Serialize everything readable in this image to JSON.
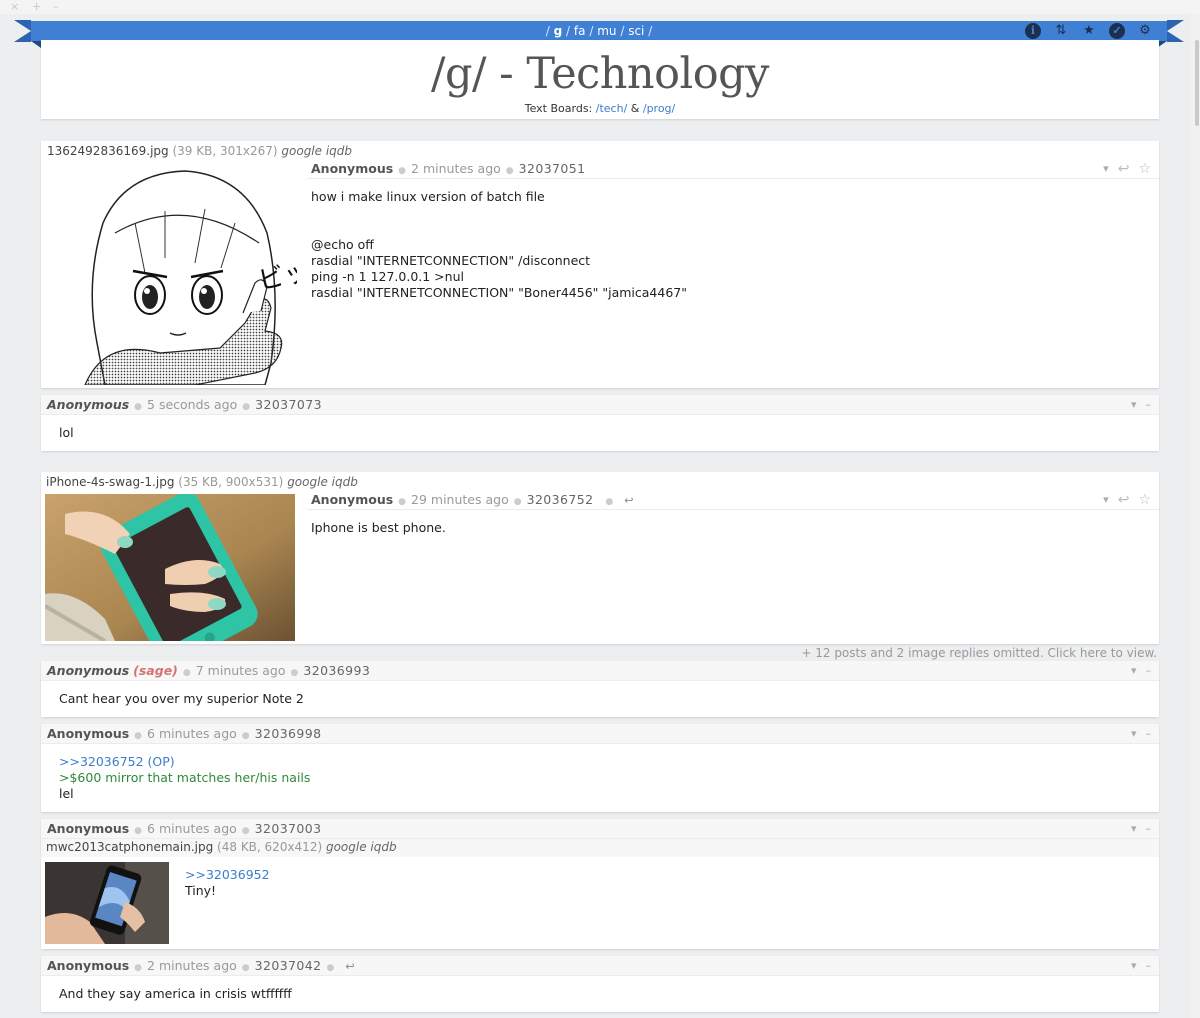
{
  "window": {
    "controls": [
      "×",
      "+",
      "–"
    ]
  },
  "nav": {
    "open": "/",
    "boards": [
      "g",
      "fa",
      "mu",
      "sci"
    ],
    "separator": "/",
    "close": "/"
  },
  "toolbar_icons": [
    "info-icon",
    "swap-icon",
    "star-icon",
    "check-bubble-icon",
    "gear-icon"
  ],
  "header": {
    "title": "/g/ - Technology",
    "subtitle_prefix": "Text Boards: ",
    "link_tech": "/tech/",
    "amp": " & ",
    "link_prog": "/prog/"
  },
  "thread1": {
    "file_name": "1362492836169.jpg",
    "file_meta": "(39 KB, 301x267)",
    "file_tools": "google iqdb",
    "op": {
      "name": "Anonymous",
      "time": "2 minutes ago",
      "no": "32037051",
      "lines": [
        "how i make linux version of batch file",
        "",
        "",
        "@echo off",
        "rasdial \"INTERNETCONNECTION\" /disconnect",
        "ping -n 1 127.0.0.1 >nul",
        "rasdial \"INTERNETCONNECTION\" \"Boner4456\" \"jamica4467\""
      ]
    },
    "reply": {
      "name": "Anonymous",
      "time": "5 seconds ago",
      "no": "32037073",
      "text": "lol"
    }
  },
  "thread2": {
    "file_name": "iPhone-4s-swag-1.jpg",
    "file_meta": "(35 KB, 900x531)",
    "file_tools": "google iqdb",
    "op": {
      "name": "Anonymous",
      "time": "29 minutes ago",
      "no": "32036752",
      "text": "Iphone is best phone."
    },
    "omitted": "+ 12 posts and 2 image replies omitted. Click here to view.",
    "reply1": {
      "name": "Anonymous",
      "sage": "(sage)",
      "time": "7 minutes ago",
      "no": "32036993",
      "text": "Cant hear you over my superior Note 2"
    },
    "reply2": {
      "name": "Anonymous",
      "time": "6 minutes ago",
      "no": "32036998",
      "quote": ">>32036752 (OP)",
      "green": ">$600 mirror that matches her/his nails",
      "text": "lel"
    },
    "reply3": {
      "name": "Anonymous",
      "time": "6 minutes ago",
      "no": "32037003",
      "file_name": "mwc2013catphonemain.jpg",
      "file_meta": "(48 KB, 620x412)",
      "file_tools": "google iqdb",
      "quote": ">>32036952",
      "text": "Tiny!"
    },
    "reply4": {
      "name": "Anonymous",
      "time": "2 minutes ago",
      "no": "32037042",
      "text": "And they say america in crisis wtffffff"
    }
  },
  "colors": {
    "ribbon": "#3f7fd4",
    "background": "#eceef0",
    "link": "#3a7ecb",
    "greentext": "#2e8a37",
    "sage": "#d47373"
  }
}
